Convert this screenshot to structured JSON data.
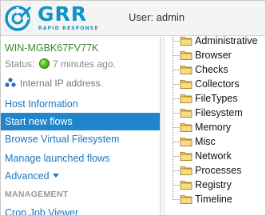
{
  "header": {
    "logo_word": "GRR",
    "logo_subtitle": "RAPID RESPONSE",
    "user_label": "User: admin",
    "brand_color": "#0e94c5"
  },
  "client": {
    "name": "WIN-MGBK67FV77K",
    "status_prefix": "Status:",
    "status_time": "7 minutes ago.",
    "status_color": "#4fc41c",
    "ip_label": "Internal IP address."
  },
  "nav": {
    "items": [
      {
        "label": "Host Information"
      },
      {
        "label": "Start new flows",
        "active": true
      },
      {
        "label": "Browse Virtual Filesystem"
      },
      {
        "label": "Manage launched flows"
      },
      {
        "label": "Advanced"
      }
    ],
    "section_management": "MANAGEMENT",
    "management_items": [
      {
        "label": "Cron Job Viewer"
      }
    ],
    "active_color": "#1f85cc",
    "link_color": "#1a77c0"
  },
  "tree": {
    "items": [
      {
        "label": "Administrative"
      },
      {
        "label": "Browser"
      },
      {
        "label": "Checks"
      },
      {
        "label": "Collectors"
      },
      {
        "label": "FileTypes"
      },
      {
        "label": "Filesystem"
      },
      {
        "label": "Memory"
      },
      {
        "label": "Misc"
      },
      {
        "label": "Network"
      },
      {
        "label": "Processes"
      },
      {
        "label": "Registry"
      },
      {
        "label": "Timeline"
      }
    ],
    "folder_icon": "folder-icon"
  }
}
